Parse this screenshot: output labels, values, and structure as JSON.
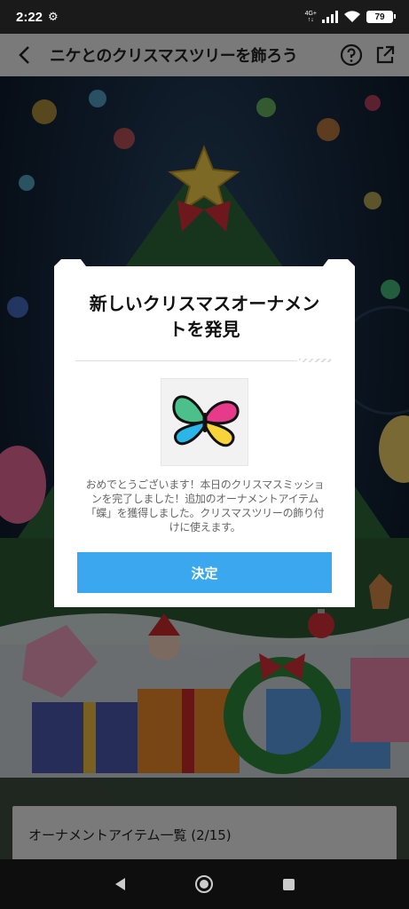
{
  "status_bar": {
    "time": "2:22",
    "network_top": "4G+",
    "network_bottom": "↑↓",
    "battery": "79"
  },
  "header": {
    "title": "ニケとのクリスマスツリーを飾ろう"
  },
  "modal": {
    "title": "新しいクリスマスオーナメントを発見",
    "message": "おめでとうございます！本日のクリスマスミッションを完了しました！追加のオーナメントアイテム「蝶」を獲得しました。クリスマスツリーの飾り付けに使えます。",
    "confirm_label": "決定",
    "accent": "#3aa7ee"
  },
  "list_bar": {
    "title": "オーナメントアイテム一覧 (2/15)"
  }
}
